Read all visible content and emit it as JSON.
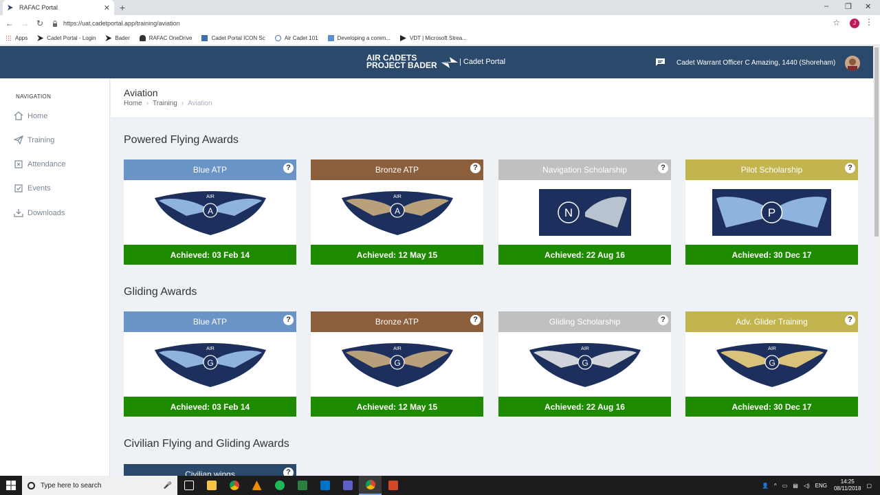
{
  "browser": {
    "tab_title": "RAFAC Portal",
    "url": "https://uat.cadetportal.app/training/aviation",
    "profile_initial": "J",
    "bookmarks": [
      "Apps",
      "Cadet Portal - Login",
      "Bader",
      "RAFAC OneDrive",
      "Cadet Portal ICON Sc",
      "Air Cadet 101",
      "Developing a comm...",
      "VDT | Microsoft Strea..."
    ]
  },
  "header": {
    "logo_line1": "AIR CADETS",
    "logo_line2": "PROJECT BADER",
    "portal_name": "| Cadet Portal",
    "user": "Cadet Warrant Officer C Amazing, 1440 (Shoreham)"
  },
  "sidebar": {
    "title": "NAVIGATION",
    "items": [
      {
        "label": "Home",
        "icon": "home-icon"
      },
      {
        "label": "Training",
        "icon": "paper-plane-icon"
      },
      {
        "label": "Attendance",
        "icon": "calendar-icon"
      },
      {
        "label": "Events",
        "icon": "check-square-icon"
      },
      {
        "label": "Downloads",
        "icon": "download-icon"
      }
    ]
  },
  "page": {
    "title": "Aviation",
    "breadcrumb": [
      "Home",
      "Training",
      "Aviation"
    ]
  },
  "sections": [
    {
      "title": "Powered Flying Awards",
      "cards": [
        {
          "title": "Blue ATP",
          "color": "#6a93c6",
          "badge_letter": "A",
          "badge_style": "wing-blue",
          "achieved": "Achieved: 03 Feb 14"
        },
        {
          "title": "Bronze ATP",
          "color": "#8b5e3c",
          "badge_letter": "A",
          "badge_style": "wing-bronze",
          "achieved": "Achieved: 12 May 15"
        },
        {
          "title": "Navigation Scholarship",
          "color": "#c0c0c0",
          "badge_letter": "N",
          "badge_style": "square-silver",
          "achieved": "Achieved: 22 Aug 16"
        },
        {
          "title": "Pilot Scholarship",
          "color": "#c2b44f",
          "badge_letter": "P",
          "badge_style": "square-blue",
          "achieved": "Achieved: 30 Dec 17"
        }
      ]
    },
    {
      "title": "Gliding Awards",
      "cards": [
        {
          "title": "Blue ATP",
          "color": "#6a93c6",
          "badge_letter": "G",
          "badge_style": "wing-blue",
          "achieved": "Achieved: 03 Feb 14"
        },
        {
          "title": "Bronze ATP",
          "color": "#8b5e3c",
          "badge_letter": "G",
          "badge_style": "wing-bronze",
          "achieved": "Achieved: 12 May 15"
        },
        {
          "title": "Gliding Scholarship",
          "color": "#c0c0c0",
          "badge_letter": "G",
          "badge_style": "wing-silver",
          "achieved": "Achieved: 22 Aug 16"
        },
        {
          "title": "Adv. Glider Training",
          "color": "#c2b44f",
          "badge_letter": "G",
          "badge_style": "wing-gold",
          "achieved": "Achieved: 30 Dec 17"
        }
      ]
    },
    {
      "title": "Civilian Flying and Gliding Awards",
      "cards": [
        {
          "title": "Civilian wings",
          "color": "#2b4a6b"
        }
      ]
    }
  ],
  "taskbar": {
    "search_placeholder": "Type here to search",
    "language": "ENG",
    "time": "14:25",
    "date": "08/11/2018"
  }
}
